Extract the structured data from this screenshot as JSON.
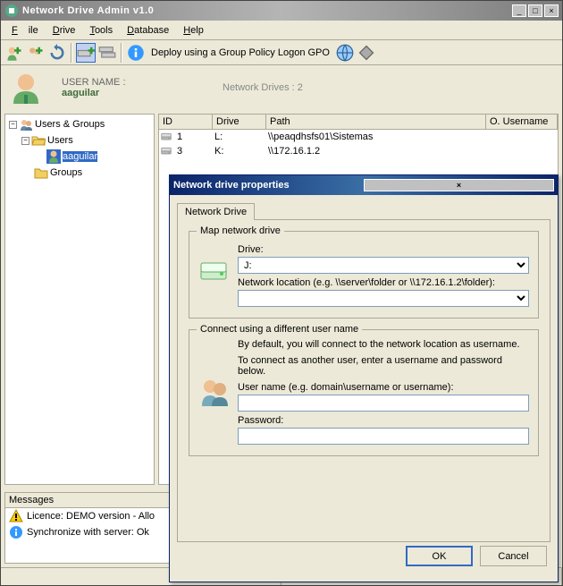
{
  "window": {
    "title": "Network Drive Admin v1.0"
  },
  "menu": {
    "file": "File",
    "drive": "Drive",
    "tools": "Tools",
    "database": "Database",
    "help": "Help"
  },
  "toolbar": {
    "deploy": "Deploy using a Group Policy Logon GPO"
  },
  "userheader": {
    "name_label": "USER NAME :",
    "name_value": "aaguilar",
    "drives_label": "Network Drives :",
    "drives_value": "2"
  },
  "tree": {
    "root": "Users & Groups",
    "users": "Users",
    "selected": "aaguilar",
    "groups": "Groups"
  },
  "grid": {
    "h_id": "ID",
    "h_drive": "Drive",
    "h_path": "Path",
    "h_ouser": "O. Username",
    "rows": [
      {
        "id": "1",
        "drive": "L:",
        "path": "\\\\peaqdhsfs01\\Sistemas"
      },
      {
        "id": "3",
        "drive": "K:",
        "path": "\\\\172.16.1.2"
      }
    ]
  },
  "messages": {
    "caption": "Messages",
    "m1": "Licence: DEMO version - Allo",
    "m2": "Synchronize with server: Ok"
  },
  "dialog": {
    "title": "Network drive properties",
    "tab": "Network Drive",
    "map_legend": "Map network drive",
    "drive_label": "Drive:",
    "drive_value": "J:",
    "loc_label": "Network location (e.g. \\\\server\\folder or \\\\172.16.1.2\\folder):",
    "loc_value": "",
    "conn_legend": "Connect using a different user name",
    "conn_text1": "By default, you will connect to the network location as username.",
    "conn_text2": "To connect as another user, enter a username and password below.",
    "user_label": "User name (e.g. domain\\username or username):",
    "user_value": "",
    "pass_label": "Password:",
    "pass_value": "",
    "ok": "OK",
    "cancel": "Cancel"
  }
}
